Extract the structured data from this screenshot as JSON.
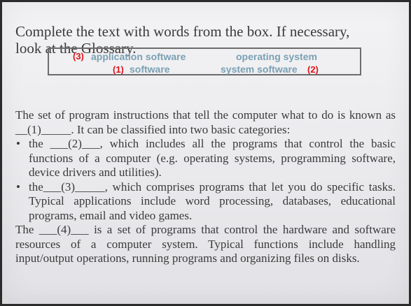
{
  "title": "Complete the text with words from the box. If necessary, look at the Glossary.",
  "word_box": {
    "item1": {
      "number": "(3)",
      "word": "application software"
    },
    "item2": {
      "word": "operating system"
    },
    "item3": {
      "number": "(1)",
      "word": "software"
    },
    "item4": {
      "word": "system software",
      "number": "(2)"
    }
  },
  "paragraphs": {
    "intro": "The set of program instructions that tell the computer what to do is known as __(1)_____. It can be classified into two basic categories:",
    "bullet_symbol": "•",
    "bullet1": "the ___(2)___, which includes all the programs that control the basic functions of a computer (e.g. operating systems, programming software, device drivers and utilities).",
    "bullet2": "the___(3)_____, which comprises programs that let you do specific tasks. Typical applications include word processing, databases, educational programs, email and video games.",
    "outro": "The ___(4)___ is a set of programs that control the hardware and software resources of a computer system. Typical functions include handling input/output operations, running programs and organizing files on disks."
  }
}
